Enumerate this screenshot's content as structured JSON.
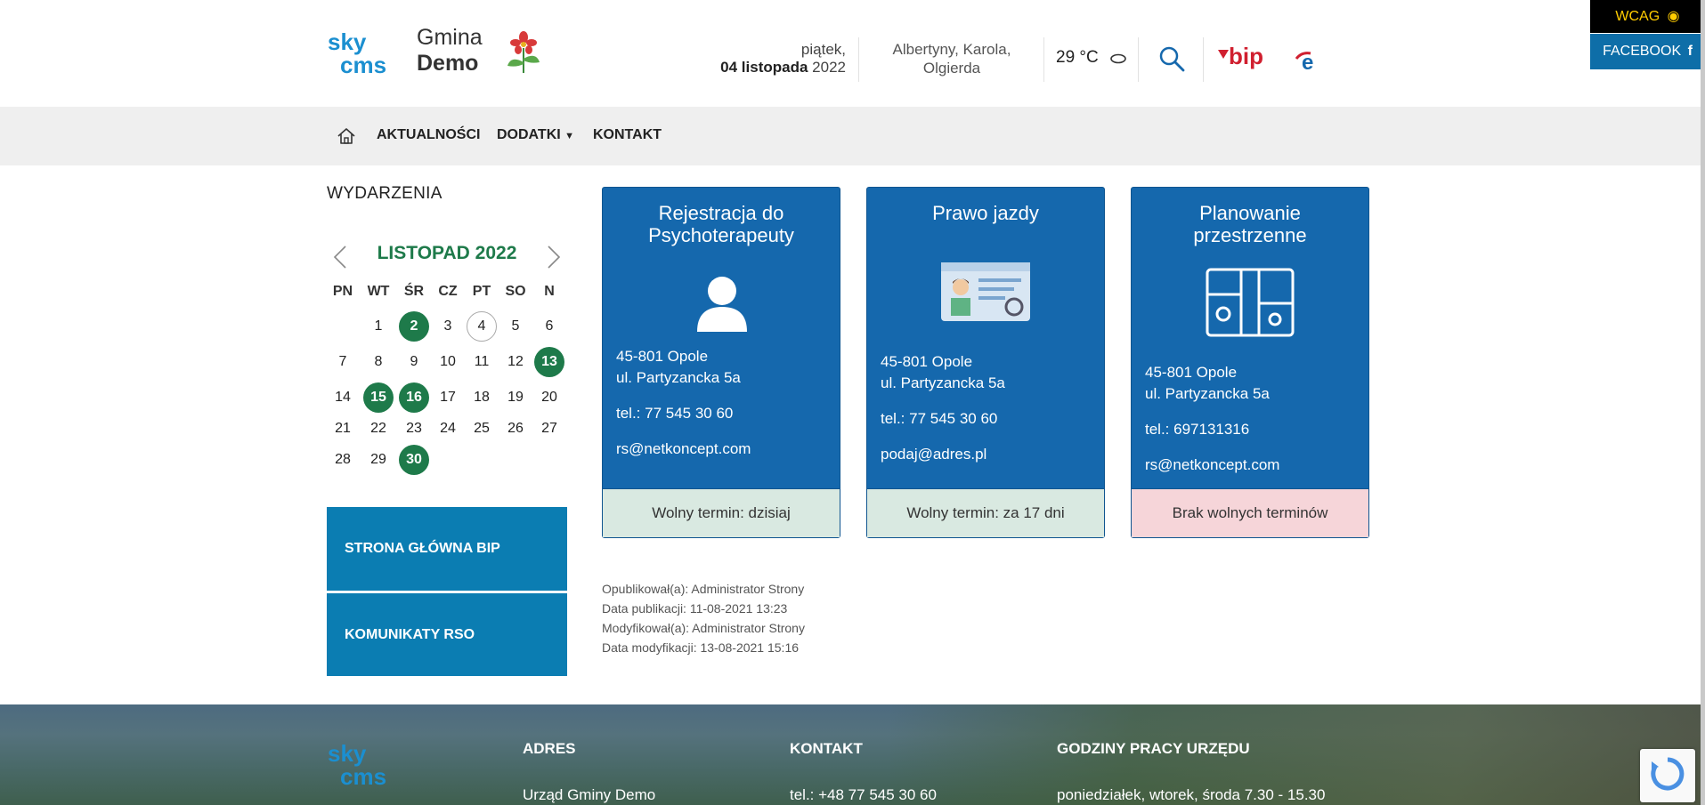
{
  "header": {
    "gmina_line1": "Gmina",
    "gmina_line2": "Demo",
    "date_weekday": "piątek,",
    "date_day_month": "04 listopada",
    "date_year": "2022",
    "names_day": "Albertyny, Karola, Olgierda",
    "temperature": "29 °C",
    "bip_label": "bip",
    "wcag_label": "WCAG",
    "facebook_label": "FACEBOOK"
  },
  "nav": {
    "items": [
      {
        "label": "AKTUALNOŚCI"
      },
      {
        "label": "DODATKI"
      },
      {
        "label": "KONTAKT"
      }
    ]
  },
  "sidebar": {
    "title": "WYDARZENIA",
    "calendar": {
      "month": "LISTOPAD 2022",
      "day_headers": [
        "PN",
        "WT",
        "ŚR",
        "CZ",
        "PT",
        "SO",
        "N"
      ],
      "event_days": [
        2,
        13,
        15,
        16,
        30
      ],
      "today": 4
    },
    "buttons": [
      {
        "label": "STRONA GŁÓWNA BIP"
      },
      {
        "label": "KOMUNIKATY RSO"
      }
    ]
  },
  "cards": [
    {
      "title": "Rejestracja do Psychoterapeuty",
      "address1": "45-801 Opole",
      "address2": "ul. Partyzancka 5a",
      "phone": "tel.: 77 545 30 60",
      "email": "rs@netkoncept.com",
      "status": "Wolny termin: dzisiaj",
      "status_color": "#d9e9e1"
    },
    {
      "title": "Prawo jazdy",
      "address1": "45-801 Opole",
      "address2": "ul. Partyzancka 5a",
      "phone": "tel.: 77 545 30 60",
      "email": "podaj@adres.pl",
      "status": "Wolny termin: za 17 dni",
      "status_color": "#d9e9e1"
    },
    {
      "title": "Planowanie przestrzenne",
      "address1": "45-801 Opole",
      "address2": "ul. Partyzancka 5a",
      "phone": "tel.: 697131316",
      "email": "rs@netkoncept.com",
      "status": "Brak wolnych terminów",
      "status_color": "#f6d5d9"
    }
  ],
  "meta": {
    "published_by": "Opublikował(a): Administrator Strony",
    "published_date": "Data publikacji: 11-08-2021 13:23",
    "modified_by": "Modyfikował(a): Administrator Strony",
    "modified_date": "Data modyfikacji: 13-08-2021 15:16"
  },
  "footer": {
    "address_heading": "ADRES",
    "address_line1": "Urząd Gminy Demo",
    "contact_heading": "KONTAKT",
    "contact_phone": "tel.: +48 77 545 30 60",
    "hours_heading": "GODZINY PRACY URZĘDU",
    "hours_line1": "poniedziałek, wtorek, środa 7.30 - 15.30"
  },
  "colors": {
    "primary_blue": "#1568ad",
    "green": "#1e7a4a",
    "sidebar_button": "#0b7db2"
  }
}
